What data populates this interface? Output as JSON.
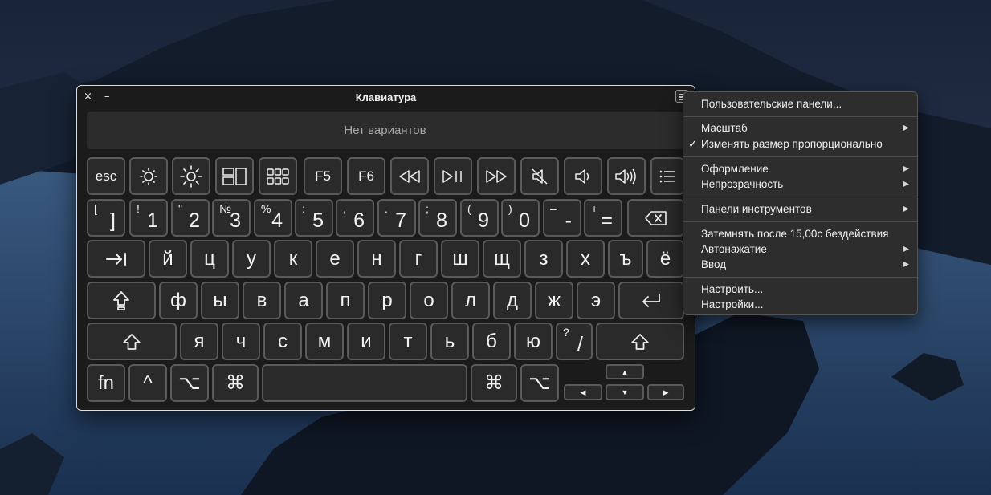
{
  "window": {
    "title": "Клавиатура",
    "close_icon": "×",
    "minimize_icon": "–"
  },
  "suggestion_bar": {
    "text": "Нет вариантов"
  },
  "keys": {
    "row0": {
      "esc": "esc",
      "f5": "F5",
      "f6": "F6"
    },
    "row1": [
      {
        "sym": "[",
        "main": "]"
      },
      {
        "sym": "!",
        "main": "1"
      },
      {
        "sym": "\"",
        "main": "2"
      },
      {
        "sym": "№",
        "main": "3"
      },
      {
        "sym": "%",
        "main": "4"
      },
      {
        "sym": ":",
        "main": "5"
      },
      {
        "sym": ",",
        "main": "6"
      },
      {
        "sym": ".",
        "main": "7"
      },
      {
        "sym": ";",
        "main": "8"
      },
      {
        "sym": "(",
        "main": "9"
      },
      {
        "sym": ")",
        "main": "0"
      },
      {
        "sym": "–",
        "main": "-"
      },
      {
        "sym": "+",
        "main": "="
      }
    ],
    "row2": [
      "й",
      "ц",
      "у",
      "к",
      "е",
      "н",
      "г",
      "ш",
      "щ",
      "з",
      "х",
      "ъ",
      "ё"
    ],
    "row3": [
      "ф",
      "ы",
      "в",
      "а",
      "п",
      "р",
      "о",
      "л",
      "д",
      "ж",
      "э"
    ],
    "row4": [
      "я",
      "ч",
      "с",
      "м",
      "и",
      "т",
      "ь",
      "б",
      "ю"
    ],
    "row4_slash": {
      "sym": "?",
      "main": "/"
    },
    "row5": {
      "fn": "fn",
      "ctrl": "^",
      "option": "⌥",
      "command": "⌘",
      "command_right": "⌘",
      "option_right": "⌥",
      "arrow_up": "▲",
      "arrow_left": "◀",
      "arrow_down": "▼",
      "arrow_right": "▶"
    }
  },
  "menu": {
    "items": [
      "Пользовательские панели...",
      "Масштаб",
      "Изменять размер пропорционально",
      "Оформление",
      "Непрозрачность",
      "Панели инструментов",
      "Затемнять после 15,00с бездействия",
      "Автонажатие",
      "Ввод",
      "Настроить...",
      "Настройки..."
    ],
    "check_mark": "✓",
    "submenu_arrow": "▶"
  },
  "icons": {
    "brightness_down": "sun-small-icon",
    "brightness_up": "sun-large-icon",
    "mission_control": "mission-control-icon",
    "launchpad": "launchpad-icon",
    "rewind": "rewind-icon",
    "play_pause": "play-pause-icon",
    "fast_forward": "fast-forward-icon",
    "mute": "mute-icon",
    "volume_down": "volume-down-icon",
    "volume_up": "volume-up-icon",
    "list": "list-icon",
    "delete": "delete-icon",
    "tab": "tab-icon",
    "caps_lock": "caps-lock-icon",
    "return": "return-icon",
    "shift": "shift-icon"
  },
  "colors": {
    "window_bg": "#1b1b1b",
    "key_bg": "#2a2a2a",
    "key_border": "#5a5a5a",
    "menu_bg": "#2d2d2e",
    "desktop": "#1c2c44"
  }
}
